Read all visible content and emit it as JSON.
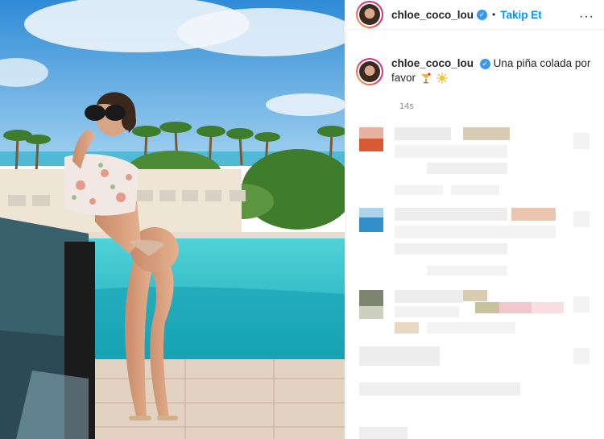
{
  "post": {
    "username": "chloe_coco_lou",
    "follow_label": "Takip Et",
    "separator": "•",
    "more_label": "···",
    "caption_user": "chloe_coco_lou",
    "caption_text": "Una piña colada por favor",
    "time": "14s",
    "verified_mark": "✓"
  },
  "icons": {
    "cocktail": "cocktail-emoji",
    "sun": "sun-emoji"
  },
  "colors": {
    "follow": "#0095f6",
    "verified": "#3897f0",
    "story_ring": "#e1306c"
  }
}
